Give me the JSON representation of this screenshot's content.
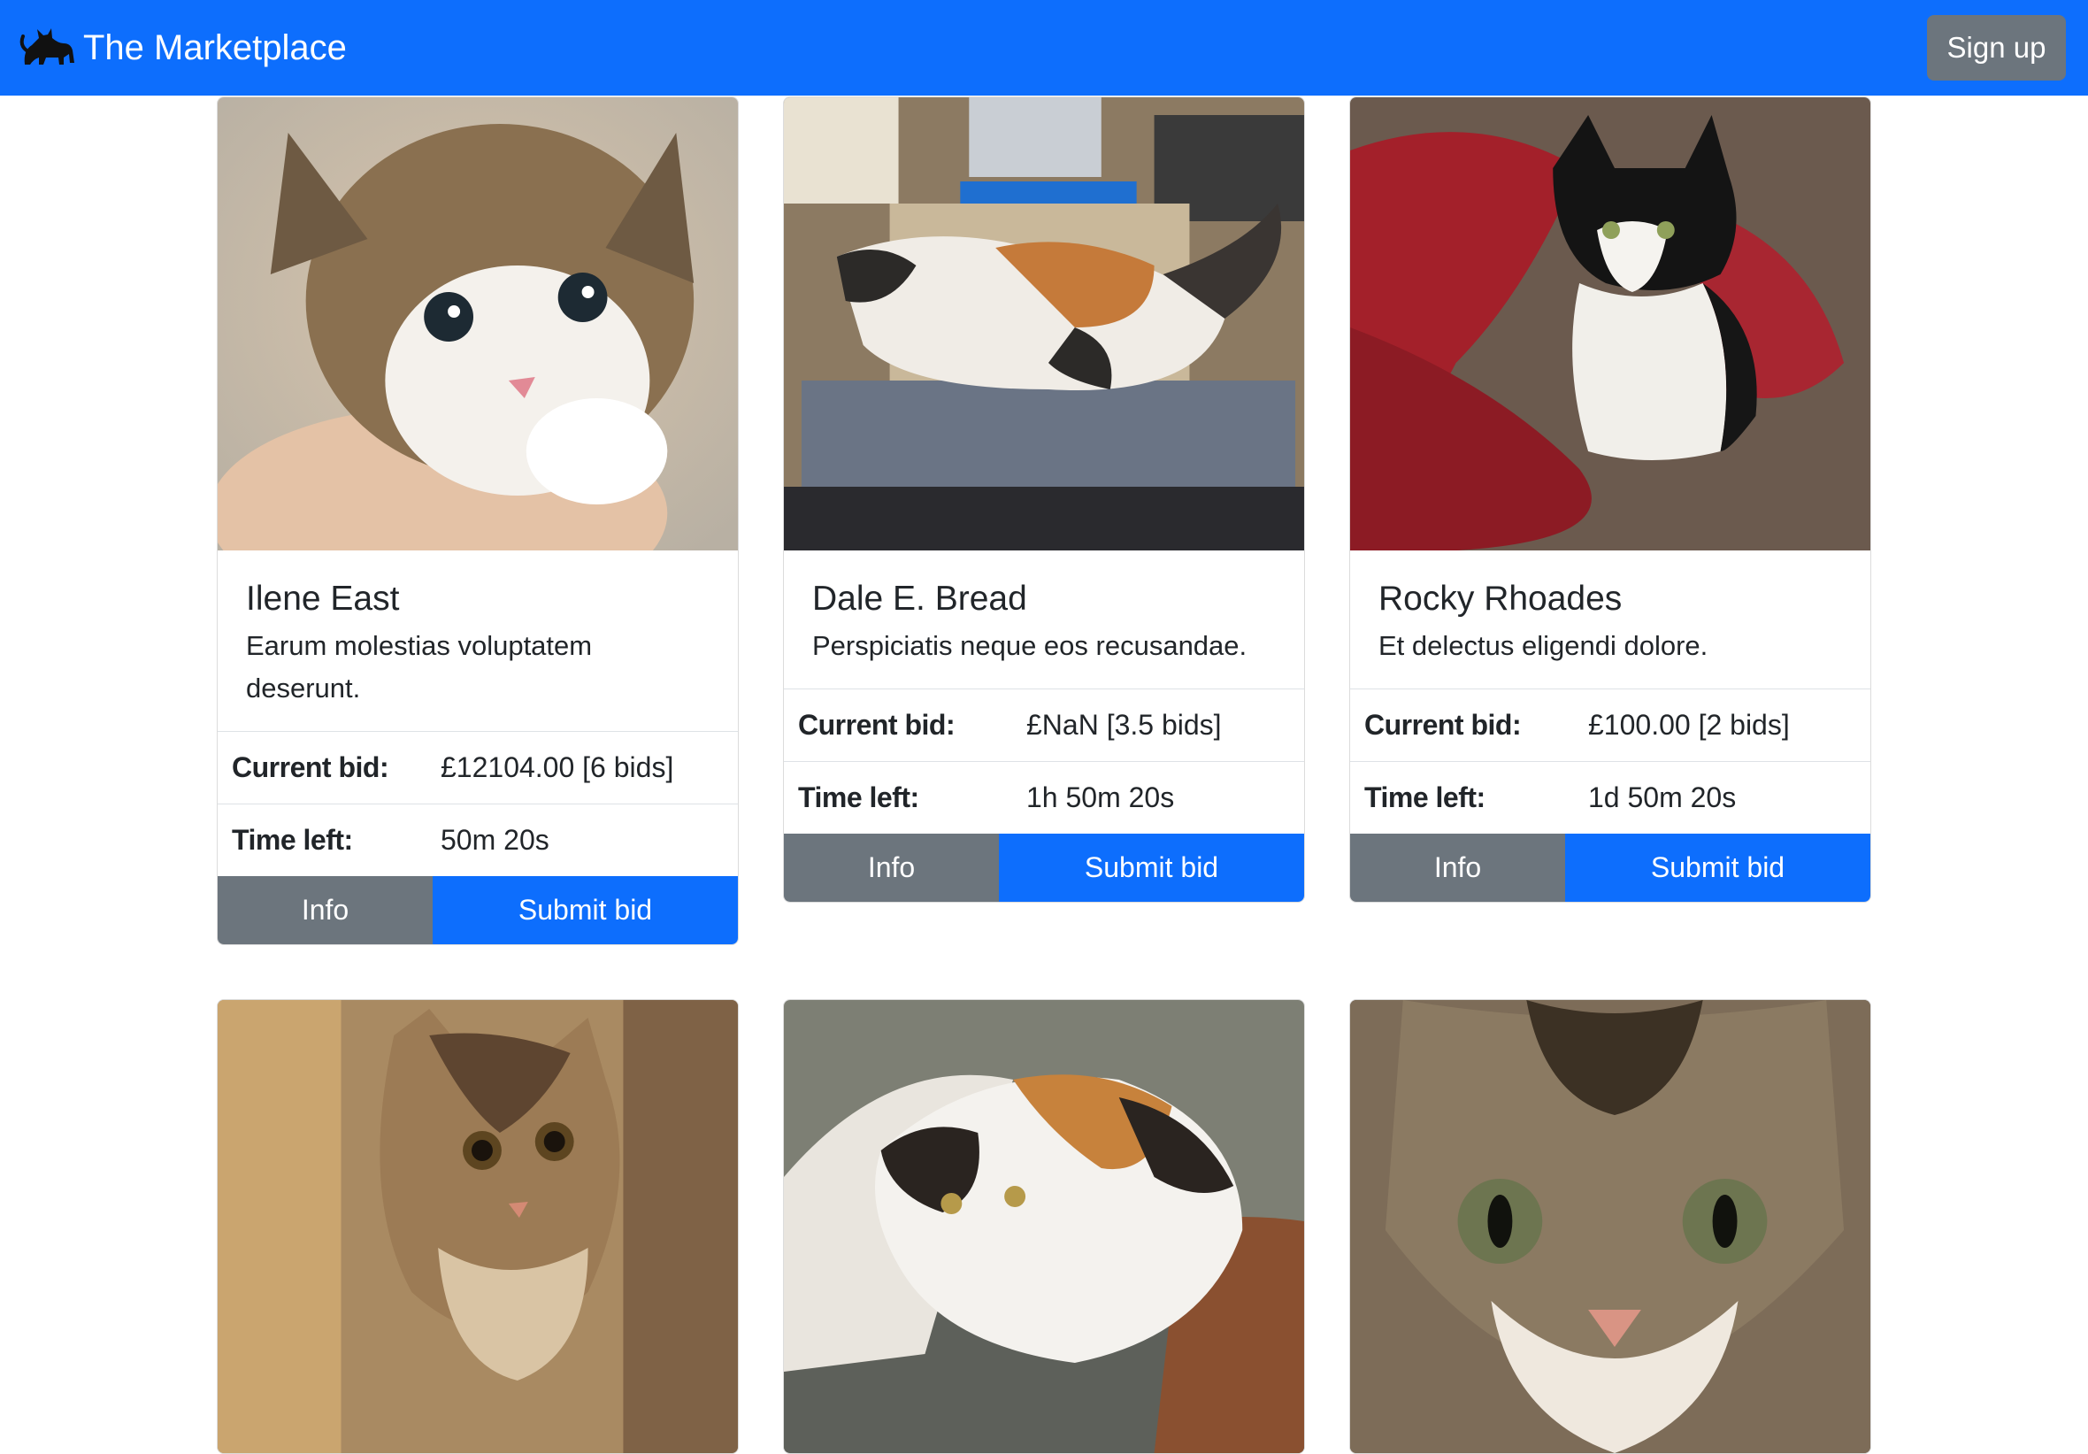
{
  "navbar": {
    "brand_icon": "cat-icon",
    "brand_name": "The Marketplace",
    "signup_label": "Sign up",
    "color": "#0d6efd"
  },
  "labels": {
    "current_bid": "Current bid:",
    "time_left": "Time left:",
    "info": "Info",
    "submit_bid": "Submit bid"
  },
  "listings": [
    {
      "name": "Ilene East",
      "description": "Earum molestias voluptatem deserunt.",
      "current_bid": "£12104.00 [6 bids]",
      "time_left": "50m 20s"
    },
    {
      "name": "Dale E. Bread",
      "description": "Perspiciatis neque eos recusandae.",
      "current_bid": "£NaN [3.5 bids]",
      "time_left": "1h 50m 20s"
    },
    {
      "name": "Rocky Rhoades",
      "description": "Et delectus eligendi dolore.",
      "current_bid": "£100.00 [2 bids]",
      "time_left": "1d 50m 20s"
    },
    {
      "name": "",
      "description": "",
      "current_bid": "",
      "time_left": ""
    },
    {
      "name": "",
      "description": "",
      "current_bid": "",
      "time_left": ""
    },
    {
      "name": "",
      "description": "",
      "current_bid": "",
      "time_left": ""
    }
  ]
}
